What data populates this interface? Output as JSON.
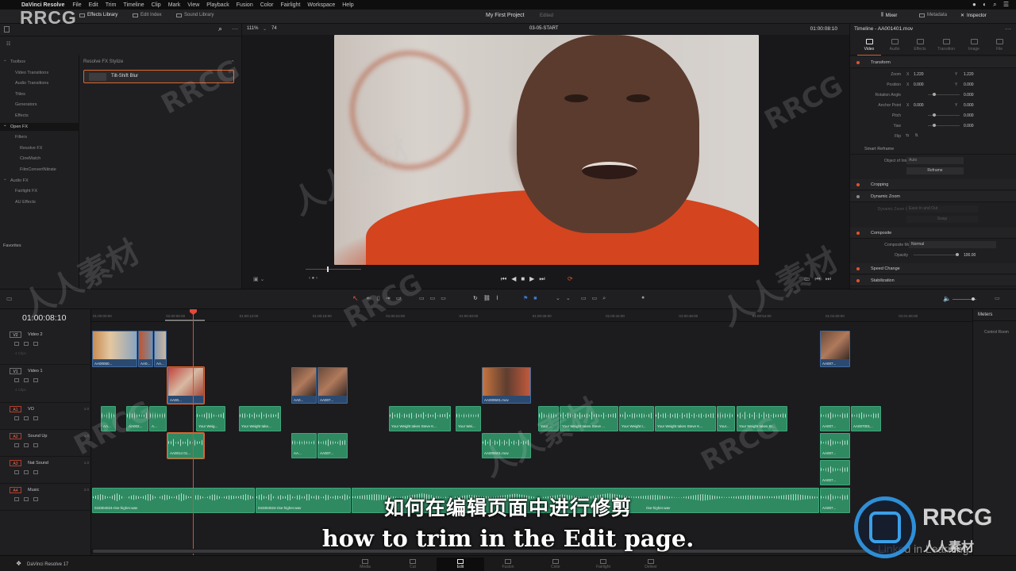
{
  "menubar": {
    "app_name": "DaVinci Resolve",
    "items": [
      "File",
      "Edit",
      "Trim",
      "Timeline",
      "Clip",
      "Mark",
      "View",
      "Playback",
      "Fusion",
      "Color",
      "Fairlight",
      "Workspace",
      "Help"
    ]
  },
  "toolbar": {
    "effects_library": "Effects Library",
    "edit_index": "Edit Index",
    "sound_library": "Sound Library",
    "project_title": "My First Project",
    "project_status": "Edited",
    "mixer": "Mixer",
    "metadata": "Metadata",
    "inspector": "Inspector"
  },
  "viewer": {
    "zoom": "111%",
    "frame_count": "74",
    "clip_name": "03-05-START",
    "timecode": "01:00:08:10"
  },
  "effects_panel": {
    "tree": [
      {
        "label": "Toolbox",
        "indent": 0,
        "selected": false
      },
      {
        "label": "Video Transitions",
        "indent": 1,
        "selected": false
      },
      {
        "label": "Audio Transitions",
        "indent": 1,
        "selected": false
      },
      {
        "label": "Titles",
        "indent": 1,
        "selected": false
      },
      {
        "label": "Generators",
        "indent": 1,
        "selected": false
      },
      {
        "label": "Effects",
        "indent": 1,
        "selected": false
      },
      {
        "label": "Open FX",
        "indent": 0,
        "selected": true
      },
      {
        "label": "Filters",
        "indent": 1,
        "selected": false
      },
      {
        "label": "Resolve FX",
        "indent": 2,
        "selected": false
      },
      {
        "label": "CineMatch",
        "indent": 2,
        "selected": false
      },
      {
        "label": "FilmConvertNitrate",
        "indent": 2,
        "selected": false
      },
      {
        "label": "Audio FX",
        "indent": 0,
        "selected": false
      },
      {
        "label": "Fairlight FX",
        "indent": 1,
        "selected": false
      },
      {
        "label": "AU Effects",
        "indent": 1,
        "selected": false
      }
    ],
    "favorites": "Favorites",
    "list_title": "Resolve FX Stylize",
    "selected_effect": "Tilt-Shift Blur"
  },
  "inspector": {
    "title": "Timeline - AA001401.mov",
    "tabs": [
      {
        "label": "Video",
        "active": true
      },
      {
        "label": "Audio",
        "active": false
      },
      {
        "label": "Effects",
        "active": false
      },
      {
        "label": "Transition",
        "active": false
      },
      {
        "label": "Image",
        "active": false
      },
      {
        "label": "File",
        "active": false
      }
    ],
    "transform": {
      "title": "Transform",
      "zoom_label": "Zoom",
      "zoom_x": "1.220",
      "zoom_y": "1.220",
      "position_label": "Position",
      "position_x": "0.000",
      "position_y": "0.000",
      "rotation_label": "Rotation Angle",
      "rotation": "0.000",
      "anchor_label": "Anchor Point",
      "anchor_x": "0.000",
      "anchor_y": "0.000",
      "pitch_label": "Pitch",
      "pitch": "0.000",
      "yaw_label": "Yaw",
      "yaw": "0.000",
      "flip_label": "Flip"
    },
    "smart_reframe": {
      "title": "Smart Reframe",
      "object_label": "Object of Interest",
      "object_value": "Auto",
      "button": "Reframe"
    },
    "cropping": "Cropping",
    "dynamic_zoom": "Dynamic Zoom",
    "dynamic_zoom_ease_label": "Dynamic Zoom Ease",
    "dynamic_zoom_ease_value": "Ease In and Out",
    "dynamic_zoom_swap": "Swap",
    "composite": {
      "title": "Composite",
      "mode_label": "Composite Mode",
      "mode_value": "Normal",
      "opacity_label": "Opacity",
      "opacity_value": "100.00"
    },
    "speed_change": "Speed Change",
    "stabilization": "Stabilization"
  },
  "timeline": {
    "timecode": "01:00:08:10",
    "ruler": [
      "01:00:00:00",
      "01:00:06:00",
      "01:00:12:00",
      "01:00:18:00",
      "01:00:24:00",
      "01:00:30:00",
      "01:00:36:00",
      "01:00:42:00",
      "01:00:48:00",
      "01:00:54:00",
      "01:01:00:00",
      "01:01:06:00"
    ],
    "tracks": [
      {
        "id": "V2",
        "name": "Video 2",
        "type": "v",
        "clips_label": "4 Clips",
        "level": ""
      },
      {
        "id": "V1",
        "name": "Video 1",
        "type": "v",
        "clips_label": "4 Clips",
        "level": ""
      },
      {
        "id": "A1",
        "name": "VO",
        "type": "a",
        "clips_label": "",
        "level": "1.0"
      },
      {
        "id": "A2",
        "name": "Sound Up",
        "type": "a",
        "clips_label": "",
        "level": "1.0"
      },
      {
        "id": "A3",
        "name": "Nat Sound",
        "type": "a",
        "clips_label": "",
        "level": "1.0"
      },
      {
        "id": "A4",
        "name": "Music",
        "type": "a",
        "clips_label": "",
        "level": "2.0"
      }
    ],
    "clips": {
      "v2_a": "AA00050...",
      "v2_b": "AA0...",
      "v2_c": "AA...",
      "v2_d": "AA007...",
      "v1_a": "AA00...",
      "v1_b": "AA0...",
      "v1_c": "AA007...",
      "v1_d": "AA009501.mov",
      "vo_1": "AA...",
      "vo_2": "AA002...",
      "vo_3": "A...",
      "vo_4": "Your Weig...",
      "vo_5": "Your Weight take...",
      "vo_6": "Your Weight takes Steve K...",
      "vo_7": "Your Wei...",
      "vo_8": "Your ...",
      "vo_9": "Your Weight takes Steve ...",
      "vo_10": "Your Weight t...",
      "vo_11": "Your Weight takes Steve K...",
      "vo_12": "Your...",
      "vo_13": "Your Weight takes St...",
      "vo_14": "AA007...",
      "vo_15": "AA007001...",
      "su_1": "AA0014 01...",
      "su_2": "AA...",
      "su_3": "AA007...",
      "su_4": "AA009501.mov",
      "su_5": "AA007...",
      "ns_1": "AA007...",
      "mu_1": "043304024-rise-higher.wav",
      "mu_2": "043304024-rise-higher.wav",
      "mu_3": "AA007...",
      "mu_4": "rise-higher.wav"
    }
  },
  "meters": {
    "title": "Meters",
    "control_room": "Control Room"
  },
  "pagebar": {
    "app_label": "DaVinci Resolve 17",
    "pages": [
      {
        "label": "Media",
        "active": false
      },
      {
        "label": "Cut",
        "active": false
      },
      {
        "label": "Edit",
        "active": true
      },
      {
        "label": "Fusion",
        "active": false
      },
      {
        "label": "Color",
        "active": false
      },
      {
        "label": "Fairlight",
        "active": false
      },
      {
        "label": "Deliver",
        "active": false
      }
    ]
  },
  "subtitle": {
    "chinese": "如何在编辑页面中进行修剪",
    "english": "how to trim in the Edit page."
  },
  "watermark": {
    "logo_text": "RRCG",
    "brand_text": "RRCG",
    "brand_cn": "人人素材",
    "wm_cn": "人人素材",
    "linkedin": "Linked in Learning"
  }
}
